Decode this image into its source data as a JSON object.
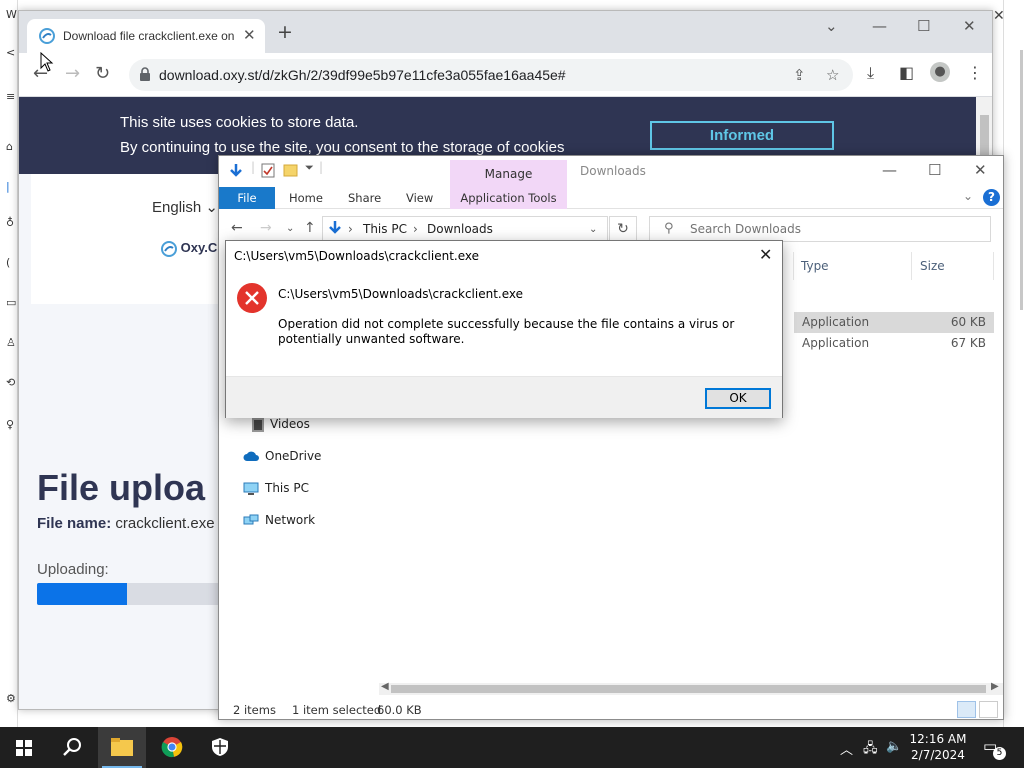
{
  "chrome": {
    "tab_title": "Download file crackclient.exe on Oxy.Cloud",
    "url": "download.oxy.st/d/zkGh/2/39df99e5b97e11cfe3a055fae16aa45e#"
  },
  "page": {
    "cookie_line1": "This site uses cookies to store data.",
    "cookie_line2": "By continuing to use the site, you consent to the storage of cookies",
    "informed_button": "Informed",
    "language": "English",
    "logo_text": "Oxy.Cl",
    "upload_title": "File uploa",
    "file_name_label": "File name:",
    "file_name_value": "crackclient.exe",
    "uploading_label": "Uploading:",
    "upload_progress": 0.45
  },
  "explorer": {
    "manage_tab": "Manage",
    "window_title": "Downloads",
    "ribbon_tabs": [
      "File",
      "Home",
      "Share",
      "View",
      "Application Tools"
    ],
    "breadcrumb": [
      "This PC",
      "Downloads"
    ],
    "search_placeholder": "Search Downloads",
    "columns": [
      "Type",
      "Size"
    ],
    "files": [
      {
        "type": "Application",
        "size": "60 KB",
        "selected": true
      },
      {
        "type": "Application",
        "size": "67 KB",
        "selected": false
      }
    ],
    "nav_items": [
      "Videos",
      "OneDrive",
      "This PC",
      "Network"
    ],
    "status_items": "2 items",
    "status_selected": "1 item selected",
    "status_size": "60.0 KB"
  },
  "dialog": {
    "title": "C:\\Users\\vm5\\Downloads\\crackclient.exe",
    "path": "C:\\Users\\vm5\\Downloads\\crackclient.exe",
    "message": "Operation did not complete successfully because the file contains a virus or potentially unwanted software.",
    "ok_label": "OK"
  },
  "taskbar": {
    "time": "12:16 AM",
    "date": "2/7/2024",
    "notification_count": "5"
  },
  "colors": {
    "cookie_bar": "#2f3553",
    "informed_accent": "#5fc6e6",
    "progress_fill": "#0b73e8",
    "explorer_file_tab": "#1979ca",
    "manage_tab": "#f2d7f7",
    "error_red": "#e3342c"
  }
}
